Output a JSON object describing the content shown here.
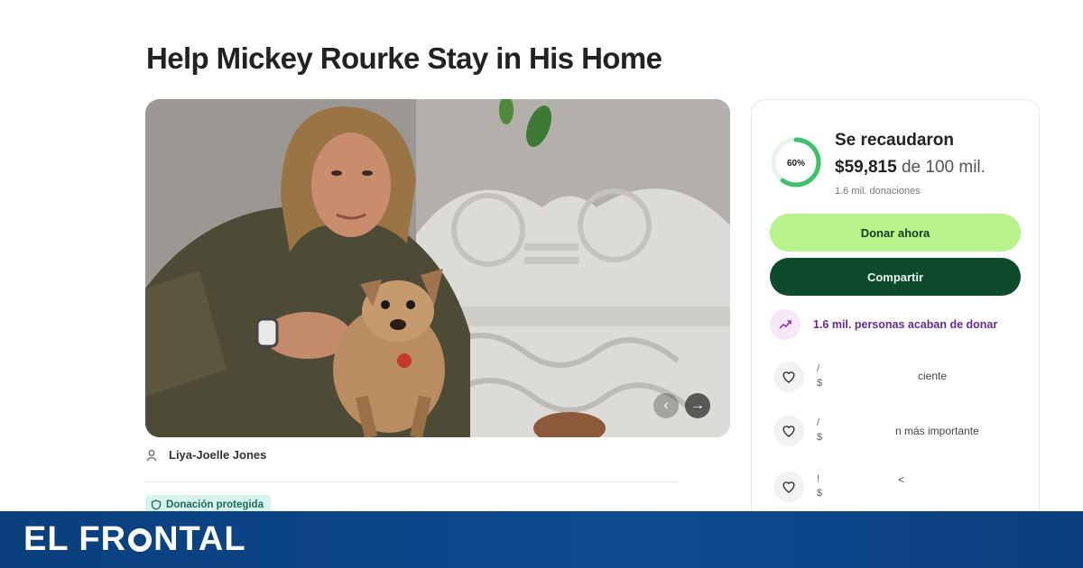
{
  "page": {
    "title": "Help Mickey Rourke Stay in His Home"
  },
  "hero": {
    "image_alt": "Photo of Mickey Rourke holding a small dog"
  },
  "organizer": {
    "name": "Liya-Joelle Jones",
    "icon": "person-icon"
  },
  "badge": {
    "label": "Donación protegida",
    "icon": "shield-icon"
  },
  "donation_card": {
    "progress_percent": 60,
    "progress_label": "60%",
    "raised_label": "Se recaudaron",
    "amount": "$59,815",
    "goal_text": "de 100 mil.",
    "donations_count": "1.6 mil. donaciones",
    "donate_button": "Donar ahora",
    "share_button": "Compartir",
    "recent_activity": "1.6 mil. personas acaban de donar",
    "donors": [
      {
        "name_fragment": "/",
        "amount_fragment": "$",
        "tag": "ciente"
      },
      {
        "name_fragment": "/",
        "amount_fragment": "$",
        "tag": "n más importante"
      },
      {
        "name_fragment": "!",
        "amount_fragment": "$",
        "tag": "<"
      }
    ]
  },
  "footer": {
    "logo_left": "EL FR",
    "logo_right": "NTAL"
  },
  "colors": {
    "accent_green": "#b7f28a",
    "dark_green": "#0e4a2c",
    "purple_text": "#6a2a8a",
    "footer_blue": "#0d4a91"
  }
}
